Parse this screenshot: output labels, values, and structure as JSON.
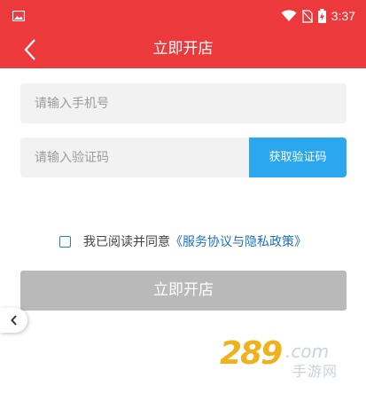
{
  "status_bar": {
    "time": "3:37",
    "icons": [
      "image-icon",
      "wifi-icon",
      "no-sim-icon",
      "battery-charging-icon"
    ]
  },
  "nav": {
    "title": "立即开店",
    "back_icon": "chevron-left-icon"
  },
  "form": {
    "phone_placeholder": "请输入手机号",
    "code_placeholder": "请输入验证码",
    "get_code_label": "获取验证码"
  },
  "agreement": {
    "checked": false,
    "text": "我已阅读并同意",
    "link": "《服务协议与隐私政策》"
  },
  "submit_label": "立即开店",
  "side_tab_icon": "chevron-left-icon",
  "watermark": {
    "number": "289",
    "domain": ".com",
    "subtitle": "手游网"
  },
  "colors": {
    "header": "#ec3a3c",
    "code_button": "#2aa7ee",
    "submit_disabled": "#b9b9b9",
    "link": "#1e6fc2"
  }
}
